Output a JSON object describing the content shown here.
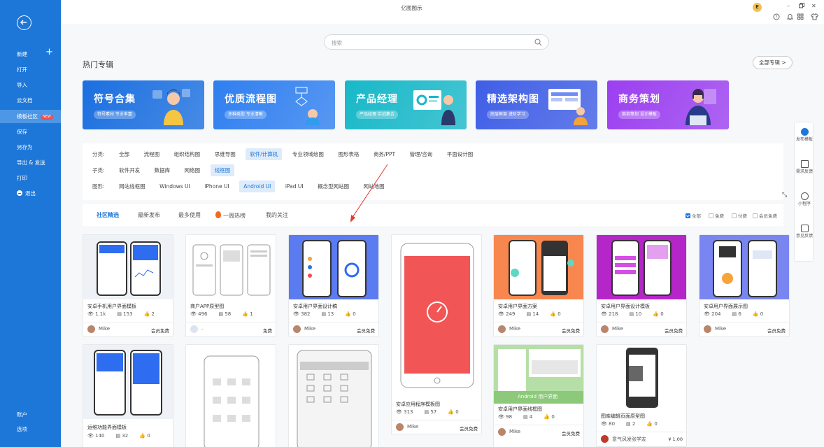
{
  "app": {
    "title": "亿图图示"
  },
  "colors": {
    "accent": "#1d77d8",
    "sidebar_bg": "#1d77d8",
    "sidebar_active": "#4d97e6",
    "new_badge": "#f24d4d"
  },
  "titlebar": {
    "avatar_letter": "E",
    "minimize": "–",
    "maximize": "ⓜ",
    "close": "✕",
    "icons": [
      "help-icon",
      "bell-icon",
      "apps-icon",
      "shirt-icon"
    ]
  },
  "sidebar": {
    "back_icon": "arrow-left-circle-icon",
    "new_plus": "+",
    "items": [
      {
        "label": "新建"
      },
      {
        "label": "打开"
      },
      {
        "label": "导入"
      },
      {
        "label": "云文档"
      },
      {
        "label": "模板社区",
        "badge": "NEW"
      },
      {
        "label": "保存"
      },
      {
        "label": "另存为"
      },
      {
        "label": "导出 & 发送"
      },
      {
        "label": "打印"
      },
      {
        "label": "退出"
      }
    ],
    "bottom": [
      {
        "label": "账户"
      },
      {
        "label": "选项"
      }
    ]
  },
  "search": {
    "placeholder": "搜索"
  },
  "hot": {
    "title": "热门专辑",
    "all_button": "全部专辑 >"
  },
  "banners": [
    {
      "title": "符号合集",
      "subtitle": "符号素材 专业丰富",
      "color": "#1b6fe0"
    },
    {
      "title": "优质流程图",
      "subtitle": "多种类型 专业清晰",
      "color": "#2f7ff0"
    },
    {
      "title": "产品经理",
      "subtitle": "产品经理 实战集合",
      "color": "#18b8c8"
    },
    {
      "title": "精选架构图",
      "subtitle": "底层框架 进阶学习",
      "color": "#3f5ee6"
    },
    {
      "title": "商务策划",
      "subtitle": "商务策划 设计模板",
      "color": "#9b3ff0"
    }
  ],
  "filters": {
    "category": {
      "label": "分类:",
      "options": [
        "全部",
        "流程图",
        "组织结构图",
        "思维导图",
        "软件/计算机",
        "专业领域绘图",
        "图形表格",
        "商务/PPT",
        "管理/咨询",
        "平面设计图"
      ],
      "selected": "软件/计算机"
    },
    "sub": {
      "label": "子类:",
      "options": [
        "软件开发",
        "数据库",
        "网络图",
        "线框图"
      ],
      "selected": "线框图"
    },
    "shape": {
      "label": "图形:",
      "options": [
        "网站线框图",
        "Windows UI",
        "iPhone UI",
        "Android UI",
        "iPad UI",
        "概念型网站图",
        "网站地图"
      ],
      "selected": "Android UI"
    }
  },
  "tabs": {
    "items": [
      "社区精选",
      "最新发布",
      "最多使用",
      "一周热榜",
      "我的关注"
    ],
    "selected": "社区精选",
    "checks": [
      {
        "label": "全部",
        "on": true
      },
      {
        "label": "免费",
        "on": false
      },
      {
        "label": "付费",
        "on": false
      },
      {
        "label": "会员免费",
        "on": false
      }
    ]
  },
  "cards": [
    {
      "title": "安卓手机用户界面模板",
      "views": "1.1k",
      "copies": "153",
      "likes": "2",
      "author": "Mike",
      "price": "会员免费"
    },
    {
      "title": "商户APP原型图",
      "views": "496",
      "copies": "58",
      "likes": "1",
      "author": ".",
      "price": "免费"
    },
    {
      "title": "安卓用户界面设计稿",
      "views": "382",
      "copies": "13",
      "likes": "0",
      "author": "Mike",
      "price": "会员免费"
    },
    {
      "title": "安卓应用程序模板图",
      "views": "313",
      "copies": "57",
      "likes": "0",
      "author": "Mike",
      "price": "会员免费"
    },
    {
      "title": "安卓用户界面方案",
      "views": "249",
      "copies": "14",
      "likes": "0",
      "author": "Mike",
      "price": "会员免费"
    },
    {
      "title": "安卓用户界面设计模板",
      "views": "218",
      "copies": "10",
      "likes": "0",
      "author": "Mike",
      "price": "会员免费"
    },
    {
      "title": "安卓用户界面展示图",
      "views": "204",
      "copies": "6",
      "likes": "0",
      "author": "Mike",
      "price": "会员免费"
    },
    {
      "title": "运维功能界面模板",
      "views": "140",
      "copies": "32",
      "likes": "0",
      "author": "",
      "price": ""
    },
    {
      "title": "安卓用户界面线框图",
      "views": "98",
      "copies": "4",
      "likes": "0",
      "author": "Mike",
      "price": "会员免费",
      "thumb_label": "Android 用户界面"
    },
    {
      "title": "图库编辑页面原型图",
      "views": "80",
      "copies": "2",
      "likes": "0",
      "author": "意气风发张学友",
      "price": "¥ 1.00"
    }
  ],
  "right_panel": [
    {
      "label": "发布模板",
      "icon": "publish-icon"
    },
    {
      "label": "需求反馈",
      "icon": "document-icon"
    },
    {
      "label": "小程序",
      "icon": "miniprogram-icon"
    },
    {
      "label": "意见反馈",
      "icon": "chat-icon"
    }
  ]
}
